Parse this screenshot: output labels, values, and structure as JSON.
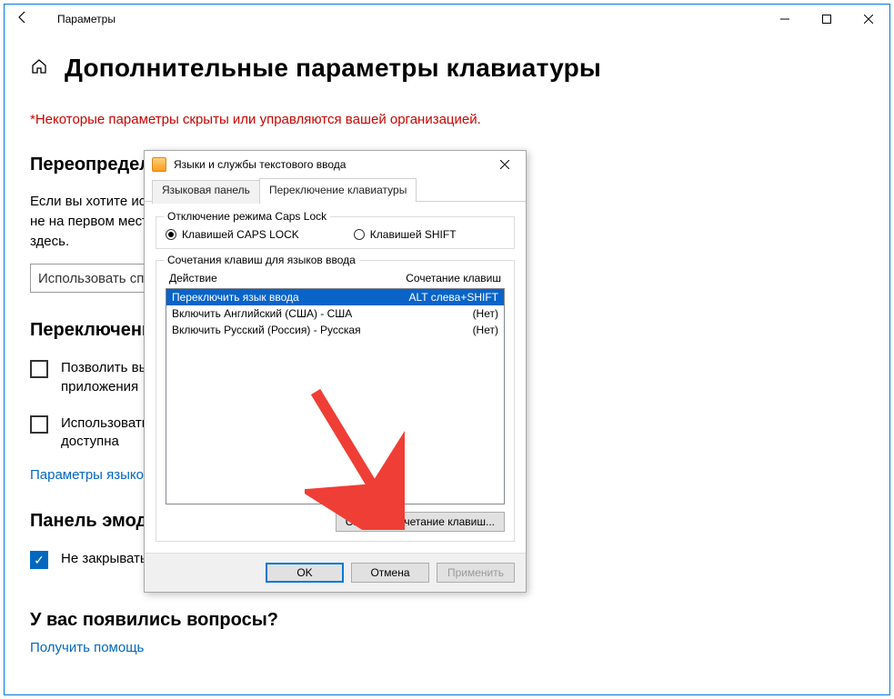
{
  "window": {
    "title": "Параметры"
  },
  "page": {
    "title": "Дополнительные параметры клавиатуры",
    "policy_note": "*Некоторые параметры скрыты или управляются вашей организацией.",
    "section_override": "Переопределени",
    "override_text_a": "Если вы хотите исп",
    "override_text_b": "не на первом мест",
    "override_text_c": "здесь.",
    "combo_label": "Использовать сп",
    "section_switch": "Переключени",
    "cb1": "Позволить выб",
    "cb1b": "приложения",
    "cb2": "Использовать",
    "cb2b": "доступна",
    "link_lang": "Параметры языков",
    "section_emoji": "Панель эмодз",
    "cb_emoji": "Не закрывать панель автоматически после ввода эмодзи",
    "section_questions": "У вас появились вопросы?",
    "link_help": "Получить помощь"
  },
  "dialog": {
    "title": "Языки и службы текстового ввода",
    "tabs": {
      "lang_panel": "Языковая панель",
      "kbd_switch": "Переключение клавиатуры"
    },
    "caps_group": "Отключение режима Caps Lock",
    "radio_caps": "Клавишей CAPS LOCK",
    "radio_shift": "Клавишей SHIFT",
    "hotkeys_group": "Сочетания клавиш для языков ввода",
    "col_action": "Действие",
    "col_keys": "Сочетание клавиш",
    "rows": [
      {
        "action": "Переключить язык ввода",
        "keys": "ALT слева+SHIFT"
      },
      {
        "action": "Включить Английский (США) - США",
        "keys": "(Нет)"
      },
      {
        "action": "Включить Русский (Россия) - Русская",
        "keys": "(Нет)"
      }
    ],
    "change_btn": "Сменить сочетание клавиш...",
    "ok": "OK",
    "cancel": "Отмена",
    "apply": "Применить"
  }
}
